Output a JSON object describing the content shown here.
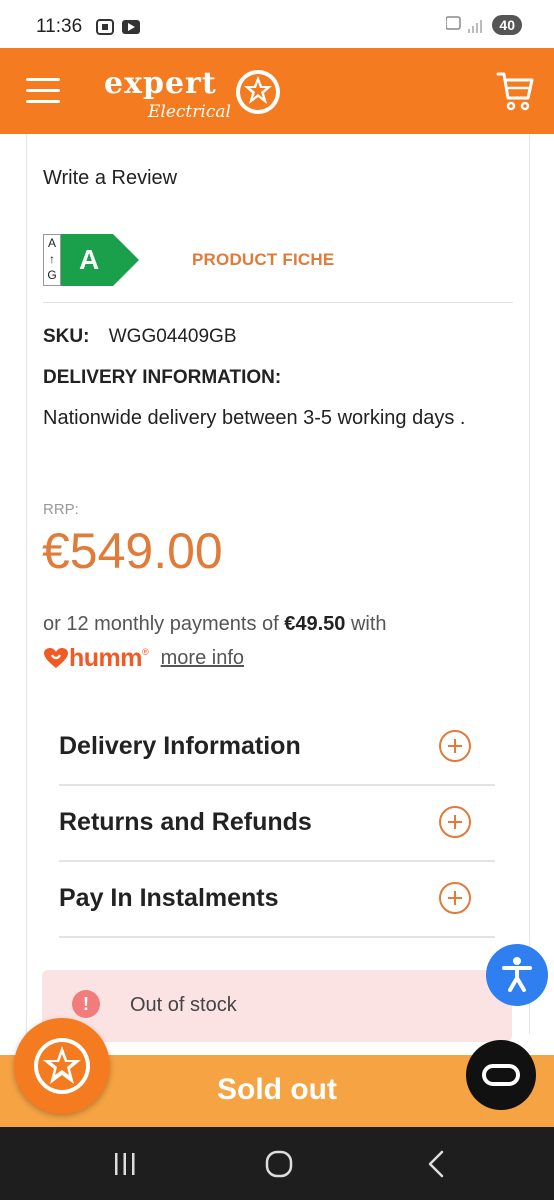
{
  "status_bar": {
    "time": "11:36",
    "battery": "40"
  },
  "header": {
    "logo_word": "expert",
    "logo_sub": "Electrical",
    "brand_color": "#f47b20"
  },
  "product": {
    "write_review": "Write a Review",
    "energy": {
      "scale_top": "A",
      "scale_arrow": "↑",
      "scale_bottom": "G",
      "rating": "A",
      "color": "#1aa04a"
    },
    "product_fiche": "PRODUCT FICHE",
    "sku_label": "SKU:",
    "sku_value": "WGG04409GB",
    "delivery_label": "DELIVERY INFORMATION:",
    "delivery_text": "Nationwide delivery between 3-5 working days .",
    "rrp_label": "RRP:",
    "price": "€549.00",
    "monthly_prefix": "or 12 monthly payments of ",
    "monthly_amount": "€49.50",
    "monthly_suffix": " with",
    "humm_logo": "humm",
    "more_info": "more info",
    "accent_color": "#e07b39"
  },
  "accordion": [
    {
      "label": "Delivery Information",
      "icon": "plus-circle-icon"
    },
    {
      "label": "Returns and Refunds",
      "icon": "plus-circle-icon"
    },
    {
      "label": "Pay In Instalments",
      "icon": "plus-circle-icon"
    }
  ],
  "stock": {
    "icon": "!",
    "text": "Out of stock"
  },
  "sold_out_label": "Sold out",
  "icons": {
    "menu": "hamburger-icon",
    "cart": "cart-icon",
    "accessibility": "accessibility-icon",
    "chat": "chat-icon",
    "nav_recents": "recents-icon",
    "nav_home": "home-icon",
    "nav_back": "back-icon"
  }
}
